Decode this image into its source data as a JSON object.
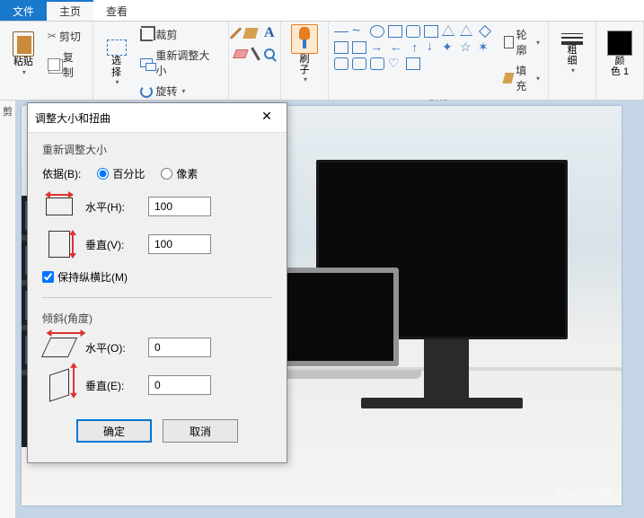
{
  "menu": {
    "file": "文件",
    "home": "主页",
    "view": "查看"
  },
  "ribbon": {
    "clipboard": {
      "paste": "粘贴",
      "cut": "剪切",
      "copy": "复制"
    },
    "image": {
      "select": "选\n择",
      "crop": "裁剪",
      "resize": "重新调整大小",
      "rotate": "旋转"
    },
    "brushes": {
      "label": "刷\n子"
    },
    "shapes": {
      "group": "形状",
      "outline": "轮廓",
      "fill": "填充"
    },
    "stroke": {
      "label": "粗\n细"
    },
    "color": {
      "label": "颜\n色 1"
    }
  },
  "leftStrip": "剪",
  "watermark": "@51CTO博客",
  "dialog": {
    "title": "调整大小和扭曲",
    "resize": {
      "section": "重新调整大小",
      "byLabel": "依据(B):",
      "percent": "百分比",
      "pixels": "像素",
      "horizontal": "水平(H):",
      "vertical": "垂直(V):",
      "hValue": "100",
      "vValue": "100",
      "keepRatio": "保持纵横比(M)"
    },
    "skew": {
      "section": "倾斜(角度)",
      "horizontal": "水平(O):",
      "vertical": "垂直(E):",
      "hValue": "0",
      "vValue": "0"
    },
    "ok": "确定",
    "cancel": "取消"
  }
}
